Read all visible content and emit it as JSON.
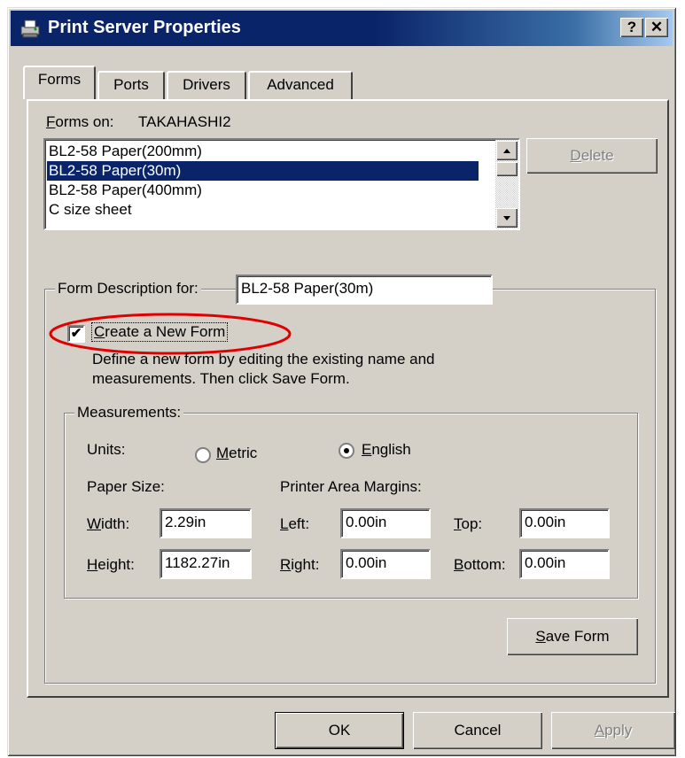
{
  "window": {
    "title": "Print Server Properties",
    "help_label": "?",
    "close_label": "✕"
  },
  "tabs": [
    {
      "label": "Forms"
    },
    {
      "label": "Ports"
    },
    {
      "label": "Drivers"
    },
    {
      "label": "Advanced"
    }
  ],
  "forms_on": {
    "label_accel": "F",
    "label_rest": "orms on:",
    "server": "TAKAHASHI2"
  },
  "forms_list": {
    "items": [
      "BL2-58 Paper(200mm)",
      "BL2-58 Paper(30m)",
      "BL2-58 Paper(400mm)",
      "C size sheet"
    ],
    "selected_index": 1
  },
  "delete_button": {
    "accel": "D",
    "rest": "elete"
  },
  "form_description": {
    "label": "Form Description for:",
    "value": "BL2-58 Paper(30m)"
  },
  "create_new_form": {
    "accel": "C",
    "rest": "reate a New Form",
    "checked": true,
    "check_glyph": "✔",
    "help_line1": "Define a new form by editing the existing name and",
    "help_line2": "measurements.  Then click Save Form."
  },
  "measurements": {
    "legend": "Measurements:",
    "units_label": "Units:",
    "metric": {
      "accel": "M",
      "rest": "etric",
      "selected": false
    },
    "english": {
      "accel": "E",
      "rest": "nglish",
      "selected": true
    },
    "paper_size_label": "Paper Size:",
    "printer_margins_label": "Printer Area Margins:",
    "width": {
      "accel": "W",
      "rest": "idth:",
      "value": "2.29in"
    },
    "height": {
      "accel": "H",
      "rest": "eight:",
      "value": "1182.27in"
    },
    "left": {
      "accel": "L",
      "rest": "eft:",
      "value": "0.00in"
    },
    "right": {
      "accel": "R",
      "rest": "ight:",
      "value": "0.00in"
    },
    "top": {
      "accel": "T",
      "rest": "op:",
      "value": "0.00in"
    },
    "bottom": {
      "accel": "B",
      "rest": "ottom:",
      "value": "0.00in"
    }
  },
  "save_form": {
    "accel": "S",
    "rest": "ave Form"
  },
  "footer": {
    "ok": "OK",
    "cancel": "Cancel",
    "apply_accel": "A",
    "apply_rest": "pply"
  },
  "colors": {
    "title_bar": "#0a246a",
    "selection": "#0a246a",
    "dialog_face": "#d4d0c8",
    "annotation_circle": "#e00000"
  }
}
